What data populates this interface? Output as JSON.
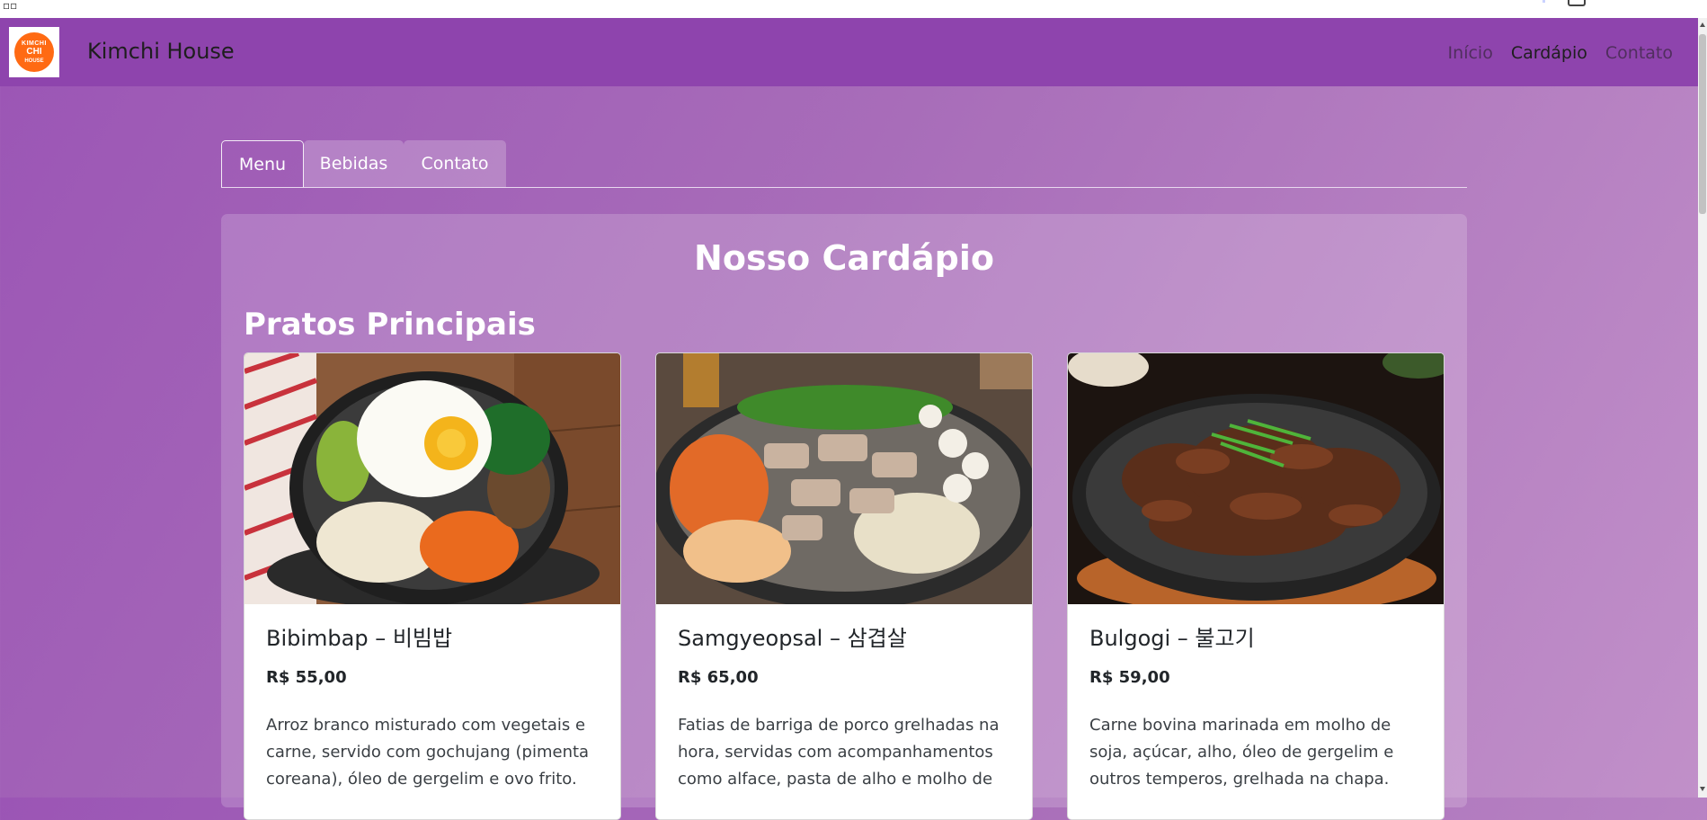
{
  "navbar": {
    "logo_text": [
      "KIMCHI",
      "CHI",
      "HOUSE"
    ],
    "brand": "Kimchi House",
    "links": [
      {
        "label": "Início",
        "active": false
      },
      {
        "label": "Cardápio",
        "active": true
      },
      {
        "label": "Contato",
        "active": false
      }
    ]
  },
  "tabs": [
    {
      "label": "Menu",
      "active": true
    },
    {
      "label": "Bebidas",
      "active": false
    },
    {
      "label": "Contato",
      "active": false
    }
  ],
  "menu": {
    "title": "Nosso Cardápio",
    "section_title": "Pratos Principais",
    "dishes": [
      {
        "name": "Bibimbap – 비빔밥",
        "price": "R$ 55,00",
        "description": "Arroz branco misturado com vegetais e carne, servido com gochujang (pimenta coreana), óleo de gergelim e ovo frito.",
        "image": "bibimbap-photo"
      },
      {
        "name": "Samgyeopsal – 삼겹살",
        "price": "R$ 65,00",
        "description": "Fatias de barriga de porco grelhadas na hora, servidas com acompanhamentos como alface, pasta de alho e molho de",
        "image": "samgyeopsal-photo"
      },
      {
        "name": "Bulgogi – 불고기",
        "price": "R$ 59,00",
        "description": "Carne bovina marinada em molho de soja, açúcar, alho, óleo de gergelim e outros temperos, grelhada na chapa.",
        "image": "bulgogi-photo"
      }
    ]
  },
  "colors": {
    "navbar": "#8e44ad",
    "logo_orange": "#ff6a13",
    "page_gradient": [
      "#9b55b5",
      "#c190c9"
    ]
  }
}
